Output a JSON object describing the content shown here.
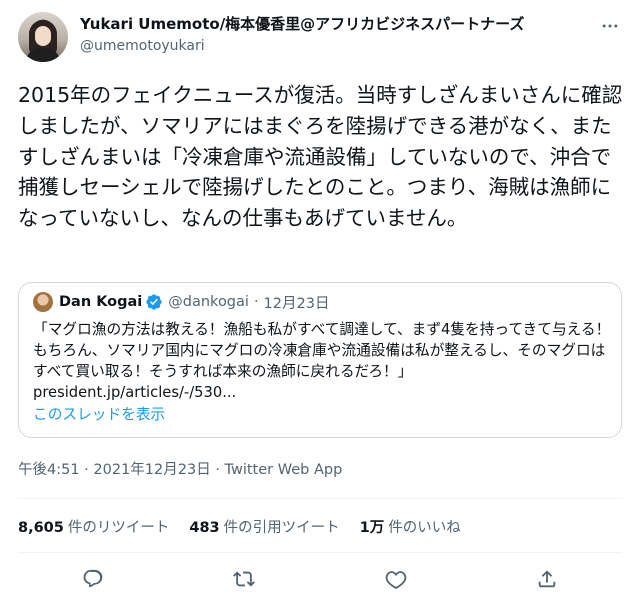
{
  "author": {
    "display_name": "Yukari Umemoto/梅本優香里@アフリカビジネスパートナーズ",
    "handle": "@umemotoyukari"
  },
  "tweet": {
    "text": "2015年のフェイクニュースが復活。当時すしざんまいさんに確認しましたが、ソマリアにはまぐろを陸揚げできる港がなく、またすしざんまいは「冷凍倉庫や流通設備」していないので、沖合で捕獲しセーシェルで陸揚げしたとのこと。つまり、海賊は漁師になっていないし、なんの仕事もあげていません。"
  },
  "quote": {
    "name": "Dan Kogai",
    "handle": "@dankogai",
    "date": "12月23日",
    "text": "「マグロ漁の方法は教える！漁船も私がすべて調達して、まず4隻を持ってきて与える！もちろん、ソマリア国内にマグロの冷凍倉庫や流通設備は私が整えるし、そのマグロはすべて買い取る！そうすれば本来の漁師に戻れるだろ！」",
    "link": "president.jp/articles/-/530...",
    "thread_label": "このスレッドを表示"
  },
  "meta": {
    "time": "午後4:51",
    "date": "2021年12月23日",
    "source": "Twitter Web App"
  },
  "stats": {
    "retweets": "8,605",
    "retweets_label": "件のリツイート",
    "quotes": "483",
    "quotes_label": "件の引用ツイート",
    "likes": "1万",
    "likes_label": "件のいいね"
  },
  "icons": {
    "more": "more-icon",
    "verified": "verified-icon",
    "reply": "reply-icon",
    "retweet": "retweet-icon",
    "like": "like-icon",
    "share": "share-icon"
  },
  "colors": {
    "accent": "#1d9bf0",
    "secondary_text": "#536471",
    "border": "#cfd9de"
  }
}
